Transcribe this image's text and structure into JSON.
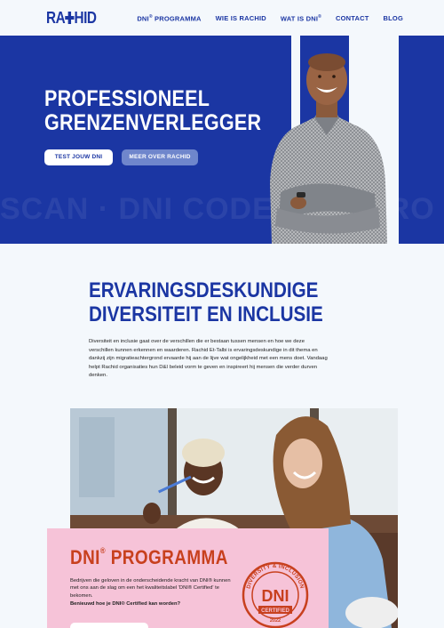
{
  "header": {
    "logo": "RACHID",
    "nav": [
      {
        "label": "DNI",
        "sup": "®",
        "rest": " PROGRAMMA"
      },
      {
        "label": "WIE IS RACHID",
        "sup": "",
        "rest": ""
      },
      {
        "label": "WAT IS DNI",
        "sup": "®",
        "rest": ""
      },
      {
        "label": "CONTACT",
        "sup": "",
        "rest": ""
      },
      {
        "label": "BLOG",
        "sup": "",
        "rest": ""
      }
    ]
  },
  "hero": {
    "title_line1": "PROFESSIONEEL",
    "title_line2": "GRENZENVERLEGGER",
    "btn_primary": "TEST JOUW DNI",
    "btn_secondary": "MEER OVER RACHID",
    "watermark": "SCAN · DNI CODE · DNI PRO · SCAN · DNI CULTURE"
  },
  "intro": {
    "title_line1": "ERVARINGSDESKUNDIGE",
    "title_line2": "DIVERSITEIT EN INCLUSIE",
    "body": "Diversiteit en inclusie gaat over de verschillen die er bestaan tussen mensen en hoe we deze verschillen kunnen erkennen en waarderen. Rachid Et-Talbi is ervaringsdeskundige in dit thema en dankzij zijn migratieachtergrond ervaarde hij aan de lijve wat ongelijkheid met een mens doet. Vandaag helpt Rachid organisaties hun D&I beleid vorm te geven en inspireert hij mensen die verder durven denken."
  },
  "card": {
    "title": "DNI",
    "title_sup": "®",
    "title_rest": " PROGRAMMA",
    "body": "Bedrijven die geloven in de onderscheidende kracht van DNI® kunnen met ons aan de slag om een het kwaliteitslabel 'DNI® Certified' te bekomen.",
    "question": "Benieuwd hoe je DNI® Certified kan worden?",
    "seal_top": "DIVERSITY & INCLUSION",
    "seal_main": "DNI",
    "seal_sub": "CERTIFIED",
    "seal_year": "2022"
  },
  "colors": {
    "brand_blue": "#1b36a3",
    "accent_orange": "#c8401e",
    "card_pink": "#f6c3d8",
    "background": "#f4f8fc"
  }
}
